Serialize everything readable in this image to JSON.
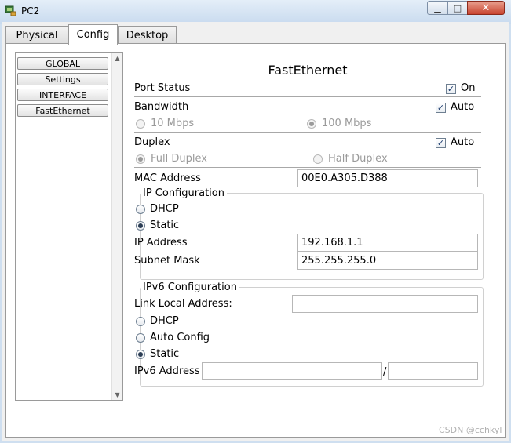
{
  "window": {
    "title": "PC2"
  },
  "tabs": [
    {
      "label": "Physical"
    },
    {
      "label": "Config"
    },
    {
      "label": "Desktop"
    }
  ],
  "sidebar": {
    "items": [
      {
        "label": "GLOBAL"
      },
      {
        "label": "Settings"
      },
      {
        "label": "INTERFACE"
      },
      {
        "label": "FastEthernet"
      }
    ]
  },
  "main": {
    "heading": "FastEthernet",
    "port_status": {
      "label": "Port Status",
      "checkbox_label": "On",
      "checked": true
    },
    "bandwidth": {
      "label": "Bandwidth",
      "checkbox_label": "Auto",
      "checked": true,
      "options": [
        {
          "label": "10 Mbps",
          "selected": false
        },
        {
          "label": "100 Mbps",
          "selected": true
        }
      ]
    },
    "duplex": {
      "label": "Duplex",
      "checkbox_label": "Auto",
      "checked": true,
      "options": [
        {
          "label": "Full Duplex",
          "selected": true
        },
        {
          "label": "Half Duplex",
          "selected": false
        }
      ]
    },
    "mac": {
      "label": "MAC Address",
      "value": "00E0.A305.D388"
    },
    "ip_config": {
      "title": "IP Configuration",
      "dhcp_label": "DHCP",
      "static_label": "Static",
      "mode": "Static",
      "ip_label": "IP Address",
      "ip_value": "192.168.1.1",
      "mask_label": "Subnet Mask",
      "mask_value": "255.255.255.0"
    },
    "ipv6_config": {
      "title": "IPv6 Configuration",
      "link_local_label": "Link Local Address:",
      "link_local_value": "",
      "dhcp_label": "DHCP",
      "auto_label": "Auto Config",
      "static_label": "Static",
      "mode": "Static",
      "address_label": "IPv6 Address",
      "address_value": "",
      "prefix_separator": "/",
      "prefix_value": ""
    }
  },
  "watermark": "CSDN @cchkyl",
  "colors": {
    "titlebar": "#c9dbef",
    "close_button": "#c8442f",
    "panel": "#ffffff"
  },
  "icons": [
    "app-icon",
    "minimize-icon",
    "maximize-icon",
    "close-icon",
    "scroll-up-icon",
    "scroll-down-icon"
  ]
}
